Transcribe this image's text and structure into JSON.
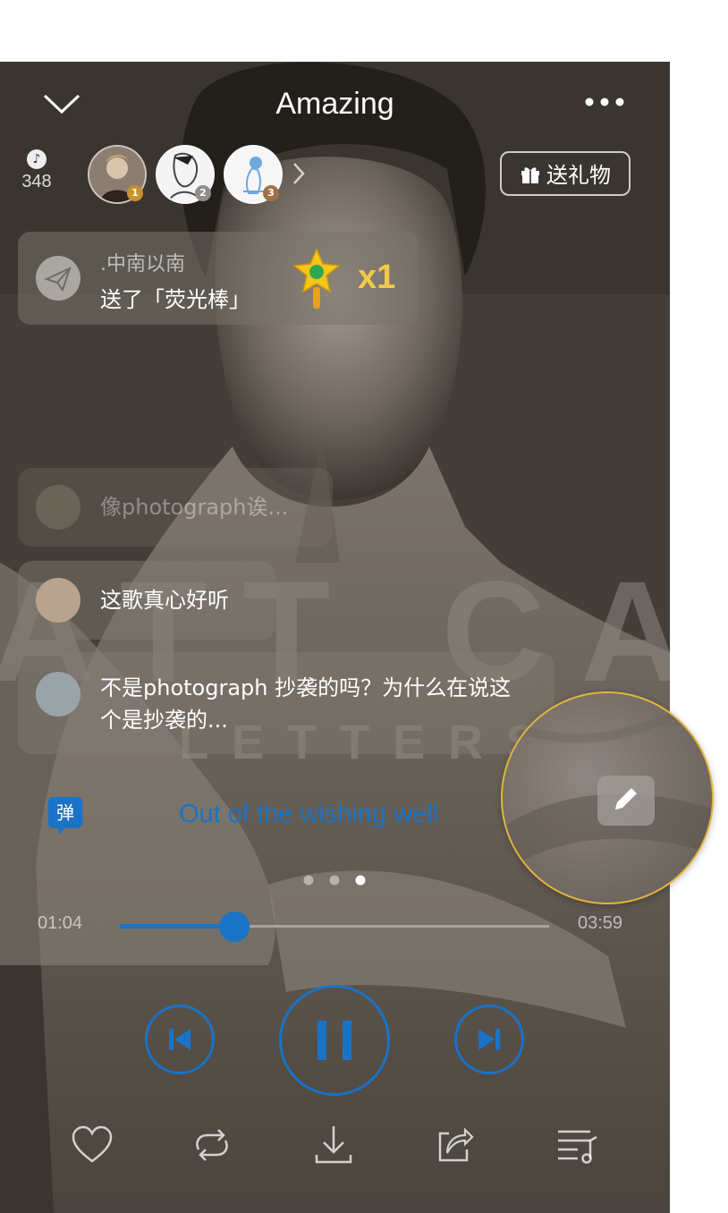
{
  "header": {
    "title": "Amazing",
    "back_icon": "chevron-down-icon",
    "more_icon": "more-horizontal-icon"
  },
  "coins": {
    "icon": "music-coin-icon",
    "count": "348"
  },
  "top_fans": [
    {
      "rank": "1",
      "rank_color": "#c8922e"
    },
    {
      "rank": "2",
      "rank_color": "#8e8e8e"
    },
    {
      "rank": "3",
      "rank_color": "#a0724a"
    }
  ],
  "gift_button": {
    "label": "送礼物",
    "icon": "gift-icon"
  },
  "gift_message": {
    "user": ".中南以南",
    "text": "送了「荧光棒」",
    "count": "x1",
    "icon": "glow-stick-icon"
  },
  "comments": [
    {
      "text": "像photograph诶..."
    },
    {
      "text": "这歌真心好听"
    },
    {
      "text": "不是photograph 抄袭的吗？为什么在说这个是抄袭的..."
    }
  ],
  "danmu_toggle": {
    "label": "弹"
  },
  "album_text": {
    "line1": "ATT CARD",
    "line2": "LETTERS"
  },
  "lyric": "Out of the wishing well",
  "pager": {
    "count": 3,
    "active": 2
  },
  "playback": {
    "current_time": "01:04",
    "total_time": "03:59",
    "progress": 0.267
  },
  "controls": {
    "prev": "skip-previous-icon",
    "play_pause": "pause-icon",
    "next": "skip-next-icon"
  },
  "bottom_bar": [
    "heart-icon",
    "repeat-icon",
    "download-icon",
    "share-icon",
    "playlist-icon"
  ],
  "colors": {
    "accent": "#1a73c6",
    "gift_count": "#f2c94c",
    "highlight_ring": "#e3b43c"
  }
}
